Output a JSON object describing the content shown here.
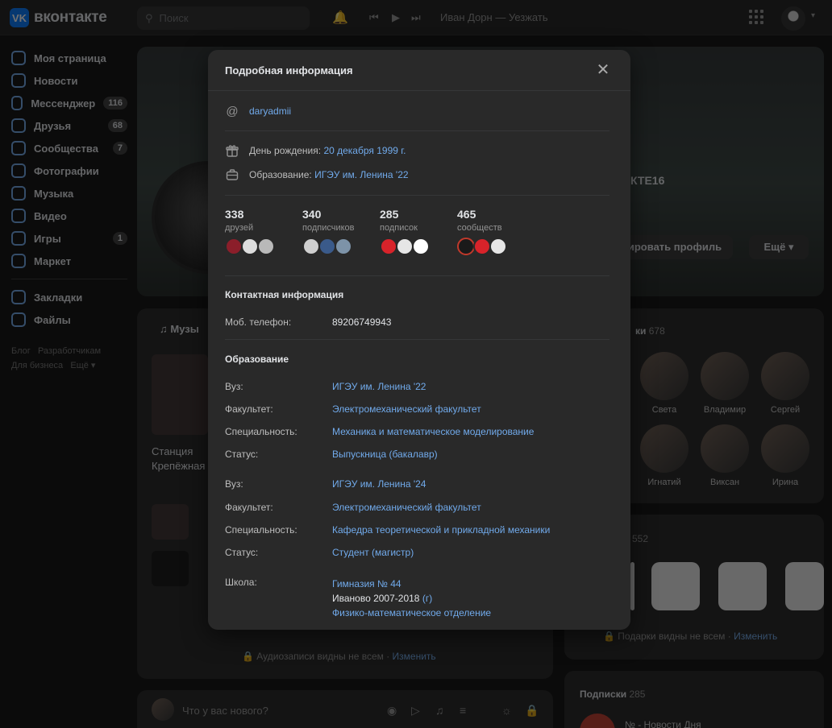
{
  "header": {
    "logo_text": "вконтакте",
    "search_placeholder": "Поиск",
    "now_playing": "Иван Дорн — Уезжать"
  },
  "sidebar": {
    "items": [
      {
        "label": "Моя страница",
        "count": ""
      },
      {
        "label": "Новости",
        "count": ""
      },
      {
        "label": "Мессенджер",
        "count": "116"
      },
      {
        "label": "Друзья",
        "count": "68"
      },
      {
        "label": "Сообщества",
        "count": "7"
      },
      {
        "label": "Фотографии",
        "count": ""
      },
      {
        "label": "Музыка",
        "count": ""
      },
      {
        "label": "Видео",
        "count": ""
      },
      {
        "label": "Игры",
        "count": "1"
      },
      {
        "label": "Маркет",
        "count": ""
      }
    ],
    "items2": [
      {
        "label": "Закладки"
      },
      {
        "label": "Файлы"
      }
    ],
    "footer": [
      "Блог",
      "Разработчикам",
      "Для бизнеса",
      "Ещё"
    ]
  },
  "profile_bg": {
    "cover_name": "КТЕ16",
    "edit_button": "ктировать профиль",
    "more_button": "Ещё",
    "music_tab": "Музы",
    "track1_title": "Станция",
    "track1_sub": "Крепёжная",
    "music_hidden": "Аудиозаписи видны не всем",
    "music_change": "Изменить",
    "post_placeholder": "Что у вас нового?",
    "friends_title": "ки",
    "friends_count": "678",
    "friends": [
      "Света",
      "Владимир",
      "Сергей",
      "Игнатий",
      "Виксан",
      "Ирина"
    ],
    "gifts_count": "552",
    "gifts_hidden": "Подарки видны не всем",
    "gifts_change": "Изменить",
    "subs_title": "Подписки",
    "subs_count": "285",
    "subs_first": "№ - Новости Дня"
  },
  "modal": {
    "title": "Подробная информация",
    "nickname": "daryadmii",
    "birthday_label": "День рождения:",
    "birthday_value": "20 декабря 1999 г.",
    "education_label": "Образование:",
    "education_value": "ИГЭУ им. Ленина '22",
    "stats": [
      {
        "num": "338",
        "label": "друзей"
      },
      {
        "num": "340",
        "label": "подписчиков"
      },
      {
        "num": "285",
        "label": "подписок"
      },
      {
        "num": "465",
        "label": "сообществ"
      }
    ],
    "contact_title": "Контактная информация",
    "phone_label": "Моб. телефон:",
    "phone_value": "89206749943",
    "edu_title": "Образование",
    "edu1": {
      "uni_label": "Вуз:",
      "uni": "ИГЭУ им. Ленина '22",
      "fac_label": "Факультет:",
      "fac": "Электромеханический факультет",
      "spec_label": "Специальность:",
      "spec": "Механика и математическое моделирование",
      "status_label": "Статус:",
      "status": "Выпускница (бакалавр)"
    },
    "edu2": {
      "uni_label": "Вуз:",
      "uni": "ИГЭУ им. Ленина '24",
      "fac_label": "Факультет:",
      "fac": "Электромеханический факультет",
      "spec_label": "Специальность:",
      "spec": "Кафедра теоретической и прикладной механики",
      "status_label": "Статус:",
      "status": "Студент (магистр)"
    },
    "school": {
      "label": "Школа:",
      "name": "Гимназия № 44",
      "years": "Иваново 2007-2018",
      "years_link": "(г)",
      "dept": "Физико-математическое отделение"
    }
  },
  "colors": {
    "accent": "#71aaeb",
    "brand": "#0077ff",
    "modal_bg": "#292929"
  }
}
